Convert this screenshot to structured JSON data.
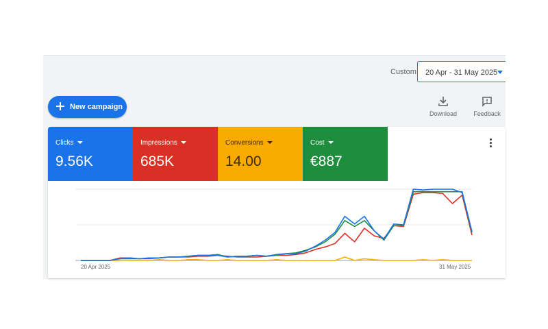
{
  "header": {
    "custom_label": "Custom",
    "date_range": "20 Apr - 31 May 2025"
  },
  "toolbar": {
    "new_campaign_label": "New campaign",
    "download_label": "Download",
    "feedback_label": "Feedback"
  },
  "colors": {
    "clicks": "#1a73e8",
    "impressions": "#d93025",
    "conversions": "#f9ab00",
    "cost": "#1e8e3e"
  },
  "metrics": [
    {
      "name": "Clicks",
      "value": "9.56K"
    },
    {
      "name": "Impressions",
      "value": "685K"
    },
    {
      "name": "Conversions",
      "value": "14.00"
    },
    {
      "name": "Cost",
      "value": "€887"
    }
  ],
  "chart_data": {
    "type": "line",
    "x_start_label": "20 Apr 2025",
    "x_end_label": "31 May 2025",
    "grid": true,
    "series": [
      {
        "color": "#1a73e8",
        "values": [
          0,
          0,
          0,
          0,
          2,
          3,
          2,
          3,
          3,
          4,
          4,
          5,
          6,
          6,
          6,
          4,
          5,
          5,
          6,
          5,
          7,
          8,
          8,
          11,
          17,
          24,
          33,
          52,
          43,
          52,
          35,
          25,
          43,
          42,
          84,
          83,
          84,
          84,
          84,
          80,
          34
        ]
      },
      {
        "color": "#d93025",
        "values": [
          0,
          0,
          0,
          0,
          3,
          3,
          2,
          2,
          3,
          4,
          4,
          4,
          5,
          5,
          6,
          5,
          4,
          4,
          4,
          5,
          6,
          6,
          7,
          9,
          13,
          16,
          20,
          32,
          22,
          38,
          29,
          26,
          41,
          40,
          78,
          80,
          80,
          79,
          67,
          77,
          30
        ]
      },
      {
        "color": "#1e8e3e",
        "values": [
          0,
          0,
          0,
          0,
          2,
          2,
          2,
          3,
          3,
          4,
          4,
          5,
          6,
          6,
          7,
          4,
          5,
          5,
          6,
          5,
          6,
          8,
          9,
          12,
          16,
          22,
          31,
          47,
          40,
          47,
          35,
          24,
          41,
          41,
          81,
          81,
          81,
          81,
          81,
          81,
          33
        ]
      },
      {
        "color": "#f9ab00",
        "values": [
          0,
          0,
          0,
          0,
          0,
          0,
          0,
          0,
          1,
          0,
          0,
          1,
          1,
          0,
          0,
          1,
          0,
          0,
          0,
          0,
          1,
          0,
          0,
          0,
          0,
          0,
          0,
          4,
          0,
          2,
          1,
          0,
          0,
          0,
          0,
          1,
          0,
          1,
          0,
          0,
          0
        ]
      }
    ]
  }
}
